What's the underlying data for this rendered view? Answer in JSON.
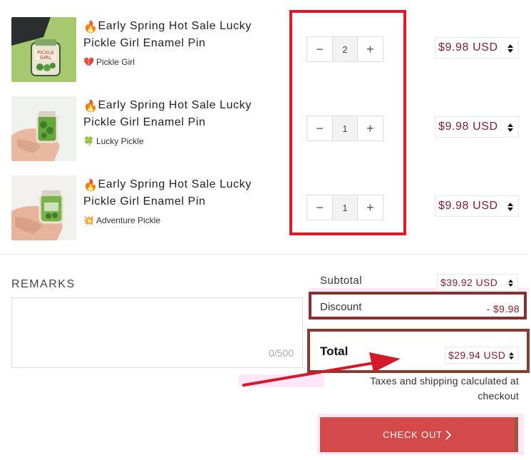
{
  "cart": {
    "items": [
      {
        "title": "Early Spring Hot Sale Lucky Pickle Girl Enamel Pin",
        "variant": "Pickle Girl",
        "variant_icon": "broken-heart-icon",
        "quantity": "2",
        "price": "$9.98 USD"
      },
      {
        "title": "Early Spring Hot Sale Lucky Pickle Girl Enamel Pin",
        "variant": "Lucky Pickle",
        "variant_icon": "clover-icon",
        "quantity": "1",
        "price": "$9.98 USD"
      },
      {
        "title": "Early Spring Hot Sale Lucky Pickle Girl Enamel Pin",
        "variant": "Adventure Pickle",
        "variant_icon": "burst-icon",
        "quantity": "1",
        "price": "$9.98 USD"
      }
    ],
    "stepper": {
      "minus": "−",
      "plus": "+"
    }
  },
  "remarks": {
    "label": "REMARKS",
    "counter": "0/500",
    "value": ""
  },
  "summary": {
    "subtotal_label": "Subtotal",
    "subtotal_value": "$39.92 USD",
    "discount_label": "Discount",
    "discount_value": "- $9.98",
    "total_label": "Total",
    "total_value": "$29.94 USD",
    "tax_note": "Taxes and shipping calculated at checkout",
    "checkout_label": "CHECK OUT"
  },
  "colors": {
    "price_text": "#8b1c2c",
    "checkout_bg": "#d44a4a",
    "quantity_highlight": "#e0162b",
    "annotation_box": "#8b2e2e",
    "annotation_arrow": "#e0162b"
  }
}
